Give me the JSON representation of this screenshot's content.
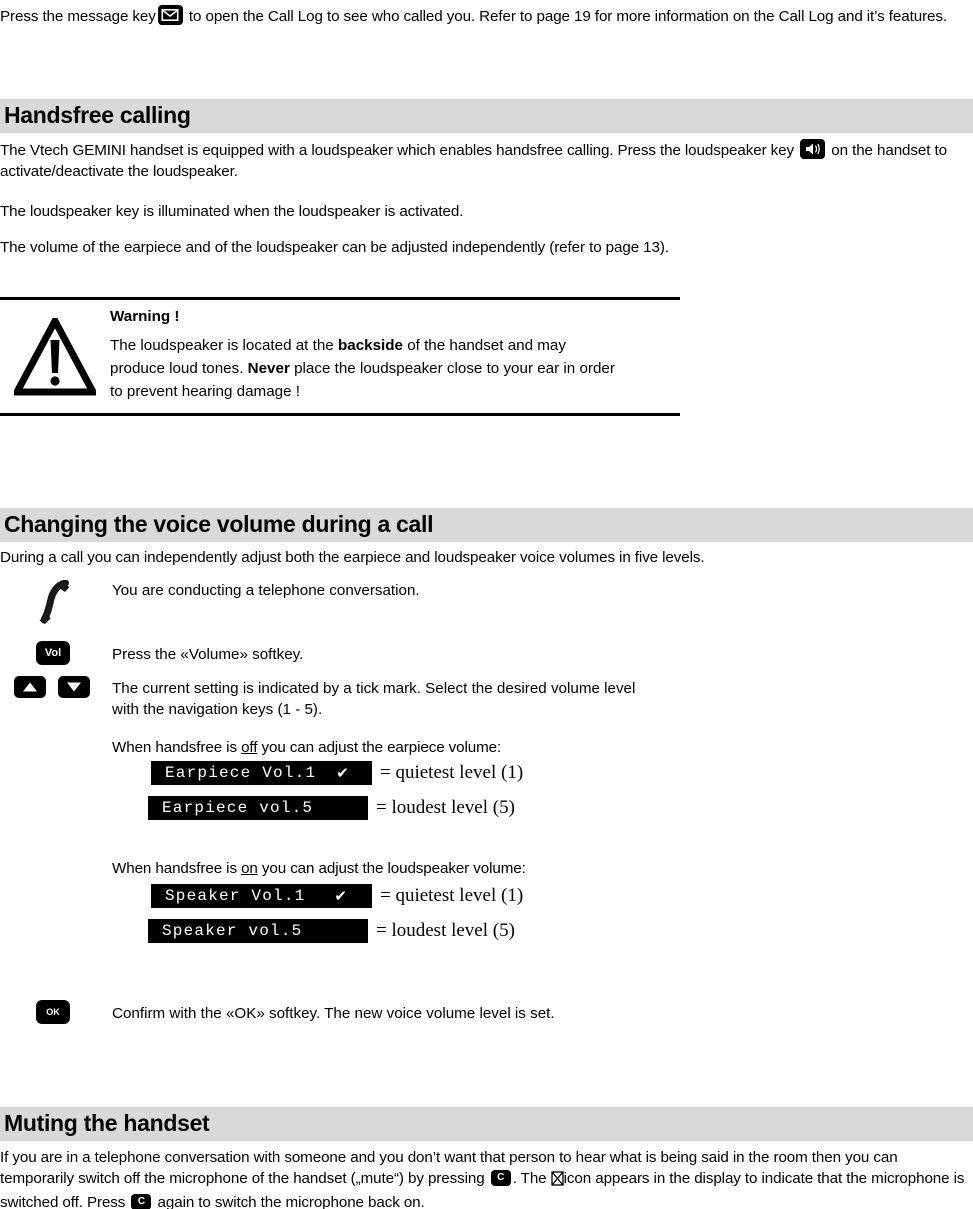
{
  "intro": {
    "line_a": "Press the message key",
    "line_b": "to open the Call Log to see who called you. Refer to page 19 for more information on the Call Log and it’s features.",
    "message_key_icon": "envelope-icon"
  },
  "handsfree": {
    "heading": "Handsfree calling",
    "p1_a": "The Vtech GEMINI handset is equipped with a loudspeaker which enables handsfree calling. Press the loudspeaker key",
    "p1_b": "on the handset to activate/deactivate the loudspeaker.",
    "p2": "The loudspeaker key is illuminated when the loudspeaker is activated.",
    "p3": "The volume of the earpiece and of the loudspeaker can be adjusted independently (refer to page 13).",
    "loudspeaker_key_icon": "loudspeaker-icon"
  },
  "warning": {
    "icon": "warning-triangle-icon",
    "title": "Warning !",
    "body_1": "The loudspeaker is located at the ",
    "body_bold_1": "backside",
    "body_2": " of the handset and may produce loud tones. ",
    "body_bold_2": "Never",
    "body_3": " place the loudspeaker close to your ear in order to prevent hearing damage !"
  },
  "volume": {
    "heading": "Changing the voice volume during a call",
    "intro": "During a call you can independently adjust both the earpiece and loudspeaker voice volumes in five levels.",
    "step1": {
      "icon": "handset-in-call-icon",
      "text": "You are conducting a telephone conversation."
    },
    "step2": {
      "icon": "vol-softkey-icon",
      "key_label": "Vol",
      "text": "Press the «Volume» softkey."
    },
    "step3": {
      "icon_up": "arrow-up-key-icon",
      "icon_down": "arrow-down-key-icon",
      "text_line1": "The current setting is indicated by a tick mark. Select the desired volume level",
      "text_line2": "with the navigation keys (1 - 5).",
      "earpiece_lead_a": "When handsfree is ",
      "earpiece_lead_u": "off",
      "earpiece_lead_b": " you can adjust the earpiece volume:",
      "speaker_lead_a": "When handsfree is ",
      "speaker_lead_u": "on",
      "speaker_lead_b": " you can adjust the loudspeaker volume:"
    },
    "displays": [
      {
        "text": "Earpiece Vol.1",
        "tick": "✔",
        "note": "= quietest level (1)"
      },
      {
        "text": "Earpiece vol.5",
        "tick": "",
        "note": "= loudest level (5)"
      },
      {
        "text": "Speaker Vol.1",
        "tick": "✔",
        "note": "= quietest level (1)"
      },
      {
        "text": "Speaker vol.5",
        "tick": "",
        "note": "= loudest level (5)"
      }
    ],
    "step4": {
      "icon": "ok-softkey-icon",
      "key_label": "OK",
      "text": "Confirm with the «OK» softkey. The new voice volume level is set."
    }
  },
  "muting": {
    "heading": "Muting the handset",
    "p_a": "If you are in a telephone conversation with someone and you don’t want that person to hear what is being said in the room then you can temporarily switch off the microphone of the handset („mute“) by pressing",
    "p_b": ". The",
    "p_c": "icon appears in the display to indicate that the microphone is switched off. Press",
    "p_d": "again to switch the microphone back on.",
    "c_key_label": "C",
    "mute_icon": "mute-crossed-icon"
  },
  "colors": {
    "section_band": "#d9d9d9",
    "key_fill": "#000000",
    "text": "#000000",
    "lcd_bg": "#000000",
    "lcd_fg": "#ffffff"
  }
}
